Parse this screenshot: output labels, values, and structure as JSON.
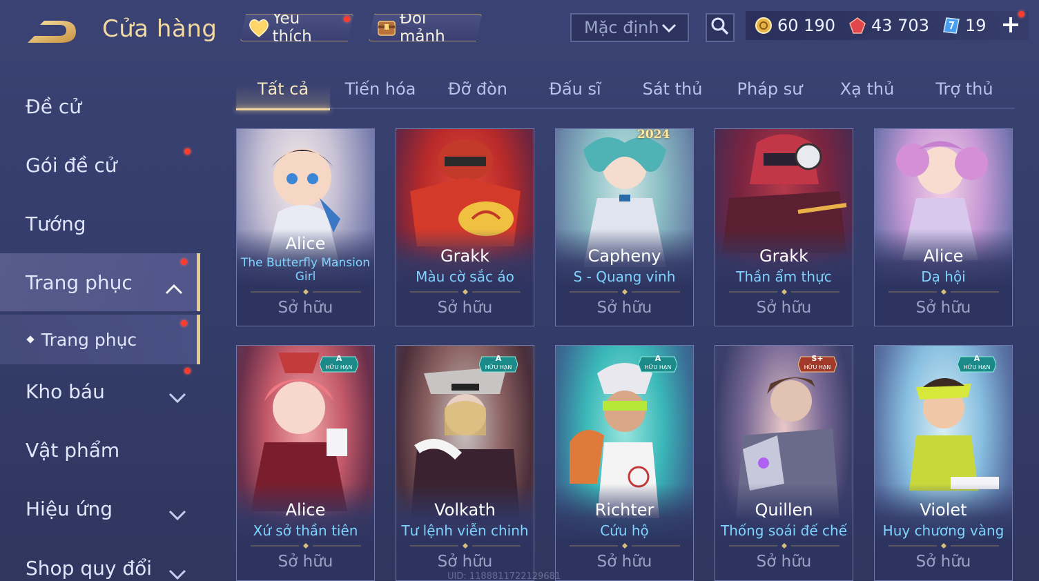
{
  "header": {
    "title": "Cửa hàng",
    "favorite_label": "Yêu thích",
    "shard_label": "Đổi mảnh",
    "sort_value": "Mặc định",
    "currencies": [
      {
        "name": "gold-coin",
        "value": "60 190"
      },
      {
        "name": "red-gem",
        "value": "43 703"
      },
      {
        "name": "blue-voucher",
        "value": "19"
      }
    ]
  },
  "sidebar": {
    "items": [
      {
        "label": "Đề cử"
      },
      {
        "label": "Gói đề cử"
      },
      {
        "label": "Tướng"
      },
      {
        "label": "Trang phục"
      },
      {
        "label": "Trang phục"
      },
      {
        "label": "Kho báu"
      },
      {
        "label": "Vật phẩm"
      },
      {
        "label": "Hiệu ứng"
      },
      {
        "label": "Shop quy đổi"
      }
    ]
  },
  "tabs": [
    {
      "label": "Tất cả"
    },
    {
      "label": "Tiến hóa"
    },
    {
      "label": "Đỡ đòn"
    },
    {
      "label": "Đấu sĩ"
    },
    {
      "label": "Sát thủ"
    },
    {
      "label": "Pháp sư"
    },
    {
      "label": "Xạ thủ"
    },
    {
      "label": "Trợ thủ"
    }
  ],
  "cards": [
    {
      "hero": "Alice",
      "skin": "The Butterfly Mansion Girl",
      "status": "Sở hữu"
    },
    {
      "hero": "Grakk",
      "skin": "Màu cờ sắc áo",
      "status": "Sở hữu"
    },
    {
      "hero": "Capheny",
      "skin": "S - Quang vinh",
      "status": "Sở hữu",
      "year": "2024"
    },
    {
      "hero": "Grakk",
      "skin": "Thần ẩm thực",
      "status": "Sở hữu"
    },
    {
      "hero": "Alice",
      "skin": "Dạ hội",
      "status": "Sở hữu"
    },
    {
      "hero": "Alice",
      "skin": "Xứ sở thần tiên",
      "status": "Sở hữu",
      "badge": "A",
      "badge_sub": "HỮU HẠN"
    },
    {
      "hero": "Volkath",
      "skin": "Tư lệnh viễn chinh",
      "status": "Sở hữu",
      "badge": "A",
      "badge_sub": "HỮU HẠN"
    },
    {
      "hero": "Richter",
      "skin": "Cứu hộ",
      "status": "Sở hữu",
      "badge": "A",
      "badge_sub": "HỮU HẠN"
    },
    {
      "hero": "Quillen",
      "skin": "Thống soái đế chế",
      "status": "Sở hữu",
      "badge": "S+",
      "badge_sub": "HỮU HẠN"
    },
    {
      "hero": "Violet",
      "skin": "Huy chương vàng",
      "status": "Sở hữu",
      "badge": "A",
      "badge_sub": "HỮU HẠN"
    }
  ],
  "footer": {
    "uid": "UID: 1188811722129681"
  },
  "colors": {
    "accent_gold": "#f2d59a",
    "skin_name": "#7fd4ff",
    "notification": "#ff3b30"
  }
}
